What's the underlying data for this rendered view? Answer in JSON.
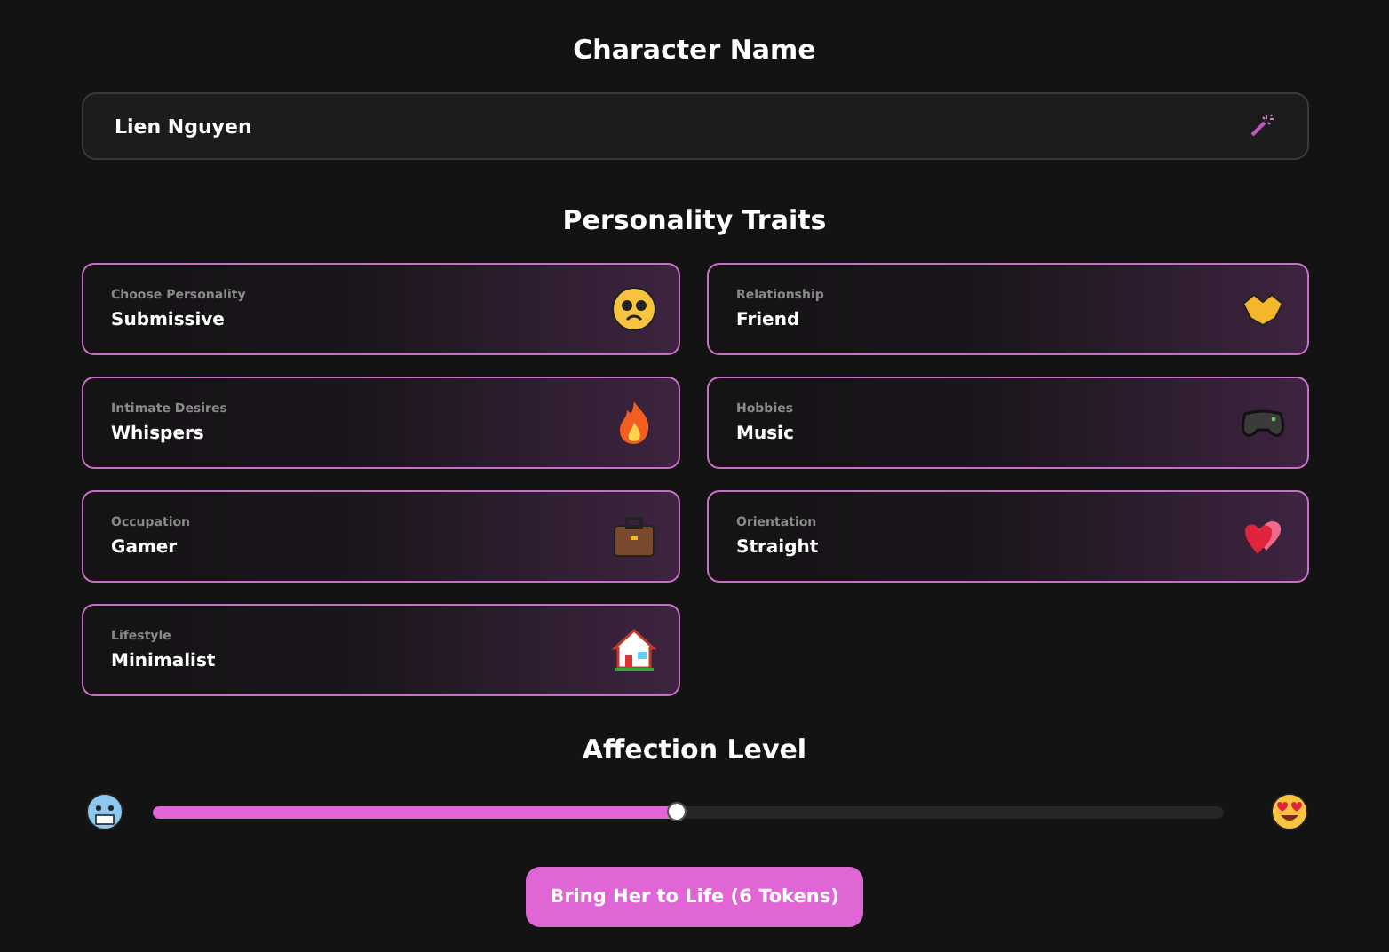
{
  "name_section": {
    "heading": "Character Name",
    "field_value": "Lien Nguyen"
  },
  "traits_section": {
    "heading": "Personality Traits",
    "traits": [
      {
        "label": "Choose Personality",
        "value": "Submissive"
      },
      {
        "label": "Relationship",
        "value": "Friend"
      },
      {
        "label": "Intimate Desires",
        "value": "Whispers"
      },
      {
        "label": "Hobbies",
        "value": "Music"
      },
      {
        "label": "Occupation",
        "value": "Gamer"
      },
      {
        "label": "Orientation",
        "value": "Straight"
      },
      {
        "label": "Lifestyle",
        "value": "Minimalist"
      }
    ]
  },
  "affection": {
    "heading": "Affection Level",
    "level": 0.49
  },
  "submit_button": "Bring Her to Life (6 Tokens)"
}
